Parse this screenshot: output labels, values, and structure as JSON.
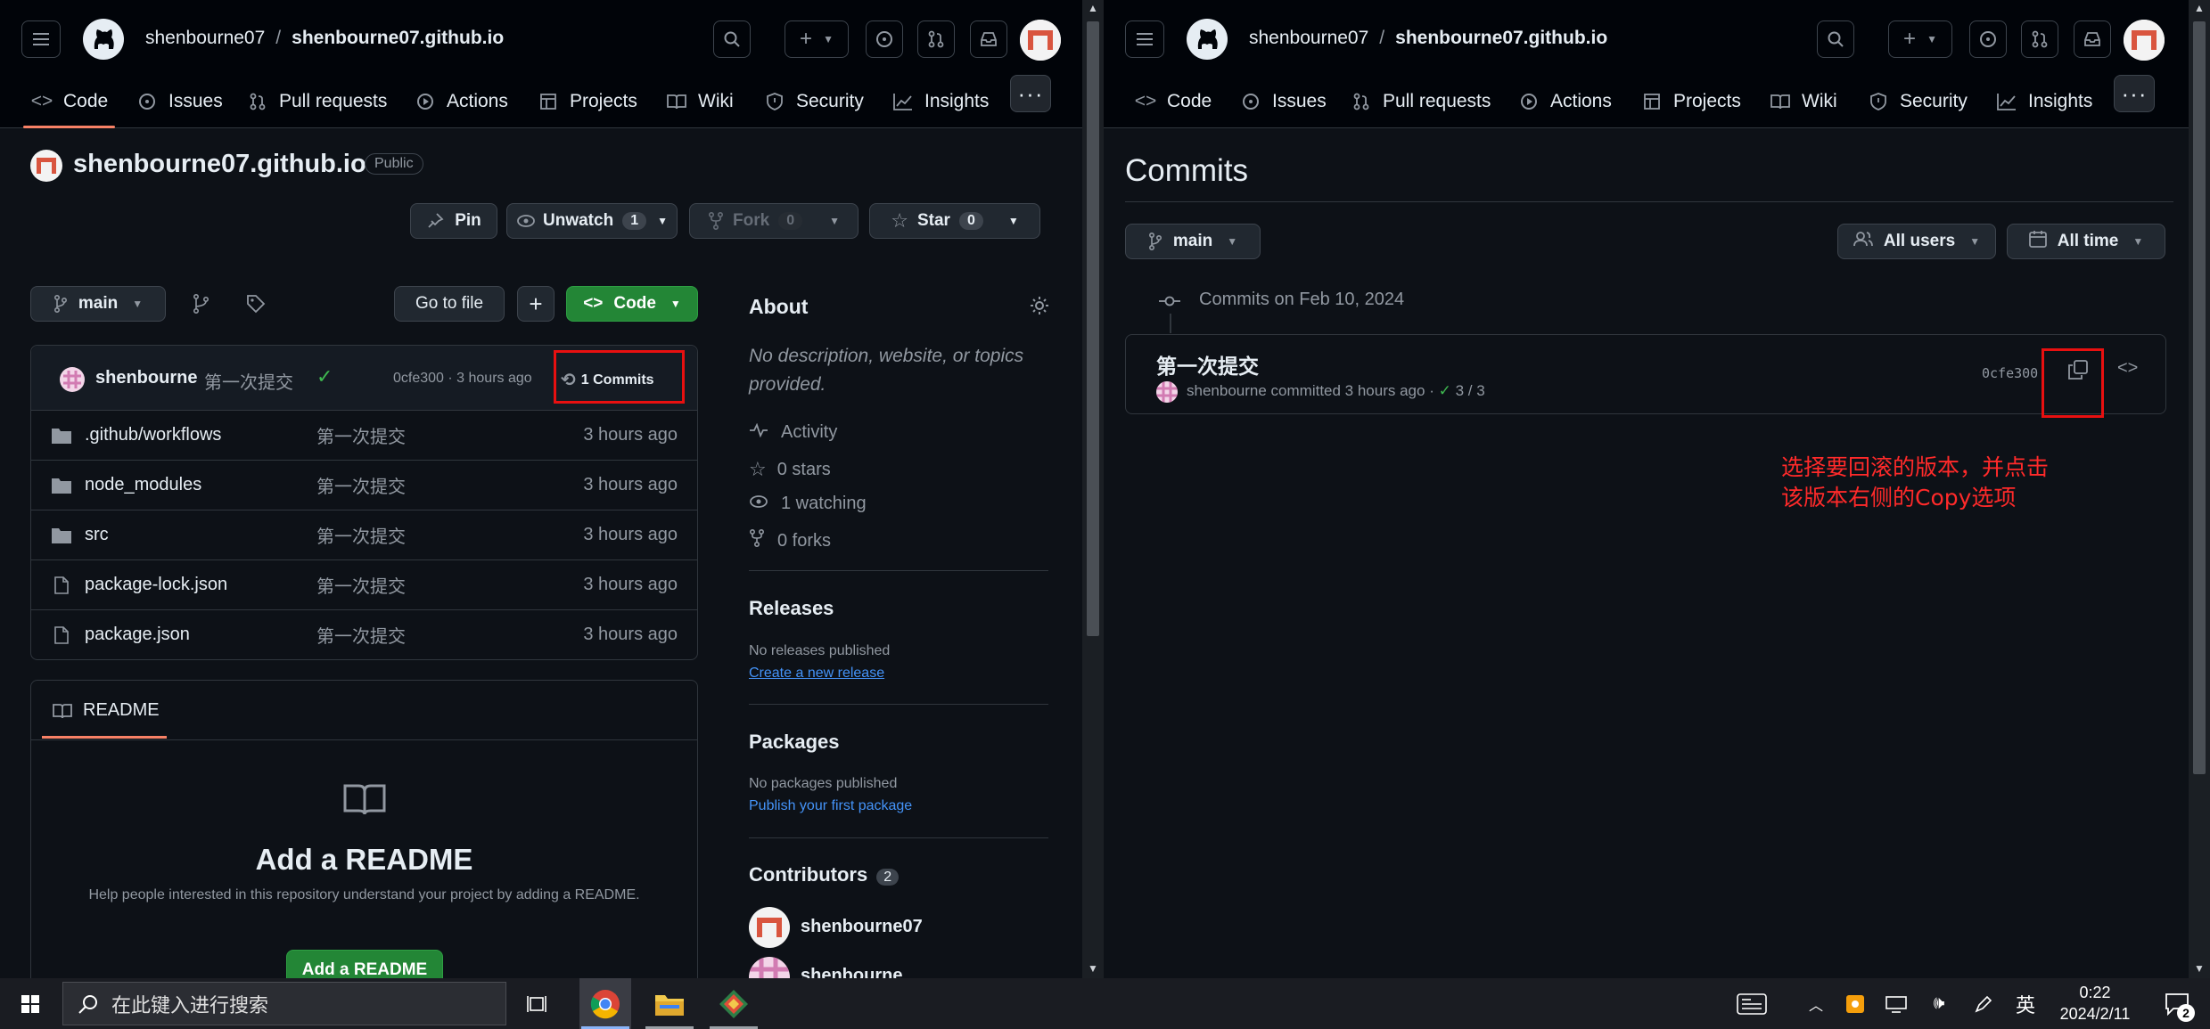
{
  "left": {
    "header": {
      "owner": "shenbourne07",
      "repo": "shenbourne07.github.io"
    },
    "tabs": [
      "Code",
      "Issues",
      "Pull requests",
      "Actions",
      "Projects",
      "Wiki",
      "Security",
      "Insights"
    ],
    "repo_title": "shenbourne07.github.io",
    "visibility": "Public",
    "actions": {
      "pin": "Pin",
      "unwatch": "Unwatch",
      "unwatch_count": "1",
      "fork": "Fork",
      "fork_count": "0",
      "star": "Star",
      "star_count": "0"
    },
    "toolbar": {
      "branch": "main",
      "goto_file": "Go to file",
      "add": "+",
      "code": "Code"
    },
    "last_commit": {
      "author": "shenbourne",
      "message": "第一次提交",
      "meta": "0cfe300 · 3 hours ago",
      "commits_link": "1 Commits"
    },
    "files": [
      {
        "name": ".github/workflows",
        "type": "folder",
        "message": "第一次提交",
        "date": "3 hours ago"
      },
      {
        "name": "node_modules",
        "type": "folder",
        "message": "第一次提交",
        "date": "3 hours ago"
      },
      {
        "name": "src",
        "type": "folder",
        "message": "第一次提交",
        "date": "3 hours ago"
      },
      {
        "name": "package-lock.json",
        "type": "file",
        "message": "第一次提交",
        "date": "3 hours ago"
      },
      {
        "name": "package.json",
        "type": "file",
        "message": "第一次提交",
        "date": "3 hours ago"
      }
    ],
    "readme": {
      "tab": "README",
      "title": "Add a README",
      "desc": "Help people interested in this repository understand your project by adding a README.",
      "button": "Add a README"
    },
    "about": {
      "title": "About",
      "description_line1": "No description, website, or topics",
      "description_line2": "provided.",
      "activity": "Activity",
      "stars": "0 stars",
      "watching": "1 watching",
      "forks": "0 forks"
    },
    "releases": {
      "title": "Releases",
      "empty": "No releases published",
      "link": "Create a new release"
    },
    "packages": {
      "title": "Packages",
      "empty": "No packages published",
      "link": "Publish your first package"
    },
    "contributors": {
      "title": "Contributors",
      "count": "2",
      "users": [
        "shenbourne07",
        "shenbourne"
      ]
    }
  },
  "right": {
    "header": {
      "owner": "shenbourne07",
      "repo": "shenbourne07.github.io"
    },
    "tabs": [
      "Code",
      "Issues",
      "Pull requests",
      "Actions",
      "Projects",
      "Wiki",
      "Security",
      "Insights"
    ],
    "page_title": "Commits",
    "branch": "main",
    "filter_users": "All users",
    "filter_time": "All time",
    "group_label": "Commits on Feb 10, 2024",
    "commit": {
      "title": "第一次提交",
      "author": "shenbourne",
      "meta": "committed 3 hours ago ·",
      "checks": "3 / 3",
      "sha": "0cfe300"
    },
    "annotation_line1": "选择要回滚的版本，并点击",
    "annotation_line2": "该版本右侧的Copy选项"
  },
  "taskbar": {
    "search_placeholder": "在此键入进行搜索",
    "ime": "英",
    "time": "0:22",
    "date": "2024/2/11",
    "notif_count": "2"
  },
  "colors": {
    "bg": "#0d1117",
    "header_bg": "#010409",
    "accent": "#f78166",
    "green": "#238636",
    "link": "#4493f8",
    "annot": "#e81010"
  }
}
